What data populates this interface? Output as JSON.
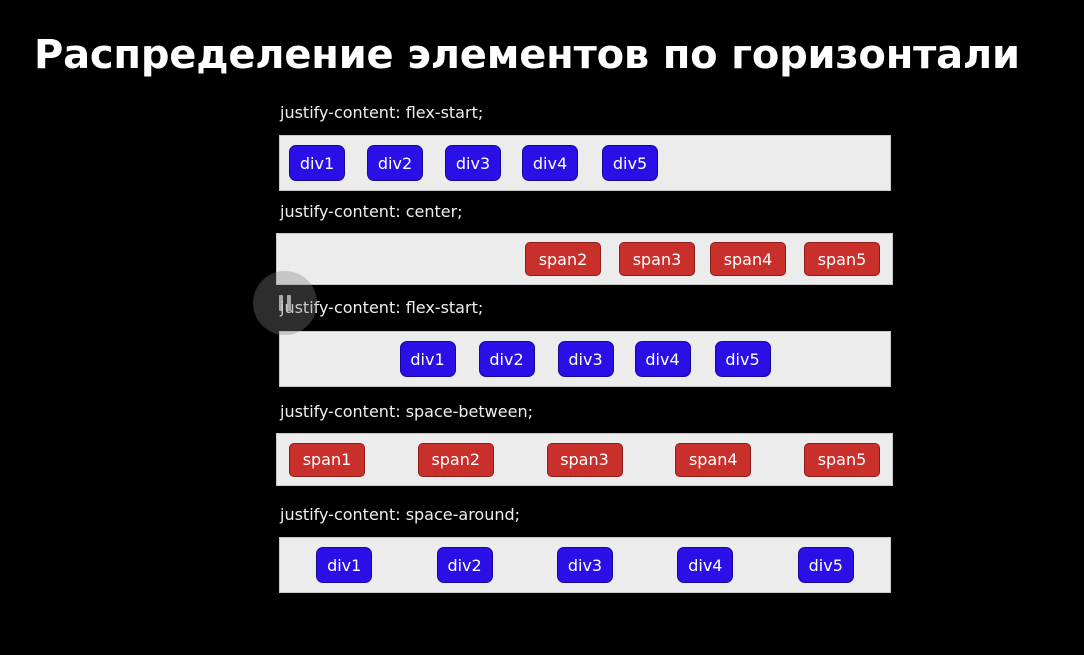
{
  "title": "Распределение элементов по горизонтали",
  "demos": [
    {
      "label": "justify-content: flex-start;",
      "items": [
        "div1",
        "div2",
        "div3",
        "div4",
        "div5"
      ]
    },
    {
      "label": "justify-content: center;",
      "items": [
        "span2",
        "span3",
        "span4",
        "span5"
      ]
    },
    {
      "label": "justify-content: flex-start;",
      "items": [
        "div1",
        "div2",
        "div3",
        "div4",
        "div5"
      ]
    },
    {
      "label": "justify-content: space-between;",
      "items": [
        "span1",
        "span2",
        "span3",
        "span4",
        "span5"
      ]
    },
    {
      "label": "justify-content: space-around;",
      "items": [
        "div1",
        "div2",
        "div3",
        "div4",
        "div5"
      ]
    }
  ],
  "icons": {
    "video_overlay": "pause-icon"
  },
  "colors": {
    "background": "#000000",
    "box_background": "#ececec",
    "div_item": "#2a0fe6",
    "span_item": "#c9302c",
    "text": "#ffffff"
  }
}
